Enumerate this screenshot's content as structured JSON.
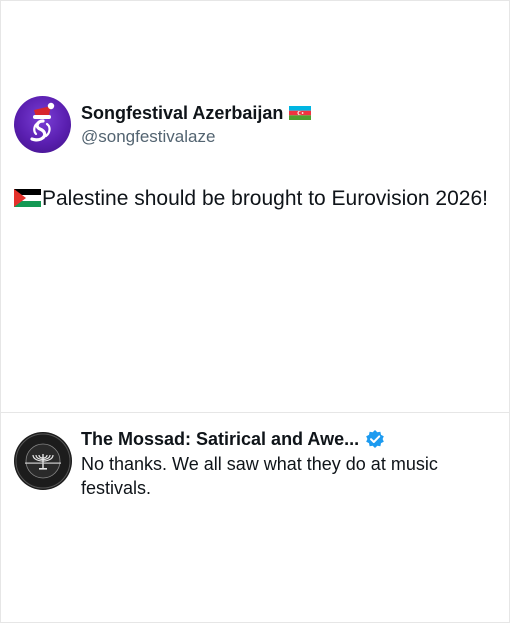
{
  "tweet": {
    "author_name": "Songfestival Azerbaijan",
    "author_handle": "@songfestivalaze",
    "text": "Palestine should be brought to Eurovision 2026!",
    "name_flag_icon": "azerbaijan-flag-icon",
    "text_flag_icon": "palestine-flag-icon"
  },
  "reply": {
    "author_name": "The Mossad: Satirical and Awe...",
    "verified_icon": "verified-badge-icon",
    "text": "No thanks. We all saw what they do at music festivals."
  },
  "colors": {
    "text": "#0f1419",
    "secondary": "#536471",
    "verified": "#1d9bf0",
    "divider": "#e6e6e6",
    "avatar_purple": "#5a1fb0"
  }
}
